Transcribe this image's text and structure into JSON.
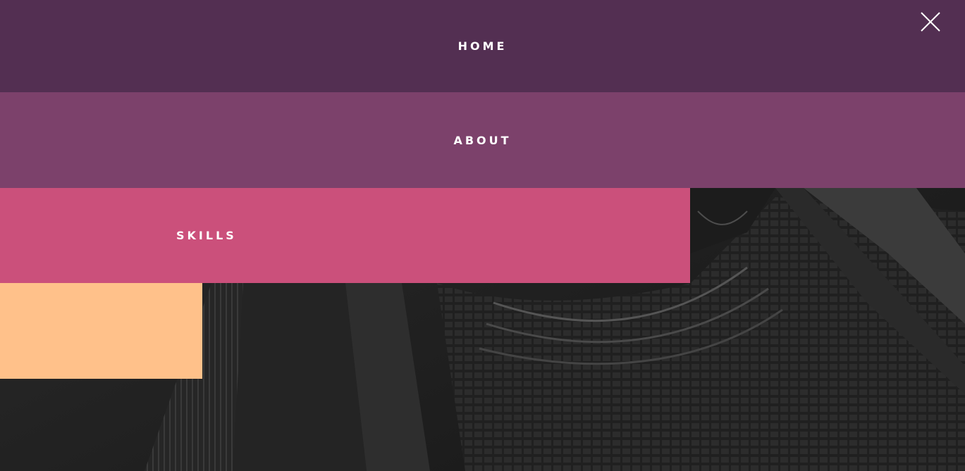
{
  "menu": {
    "items": [
      {
        "label": "HOME",
        "color": "#532f52"
      },
      {
        "label": "ABOUT",
        "color": "#7c416b"
      },
      {
        "label": "SKILLS",
        "color": "#cb507b"
      },
      {
        "label": "",
        "color": "#ffc18a"
      }
    ],
    "close_icon": "close-icon"
  },
  "background": {
    "icon": "city-buildings-photo",
    "tone": "#1e1e1e"
  }
}
